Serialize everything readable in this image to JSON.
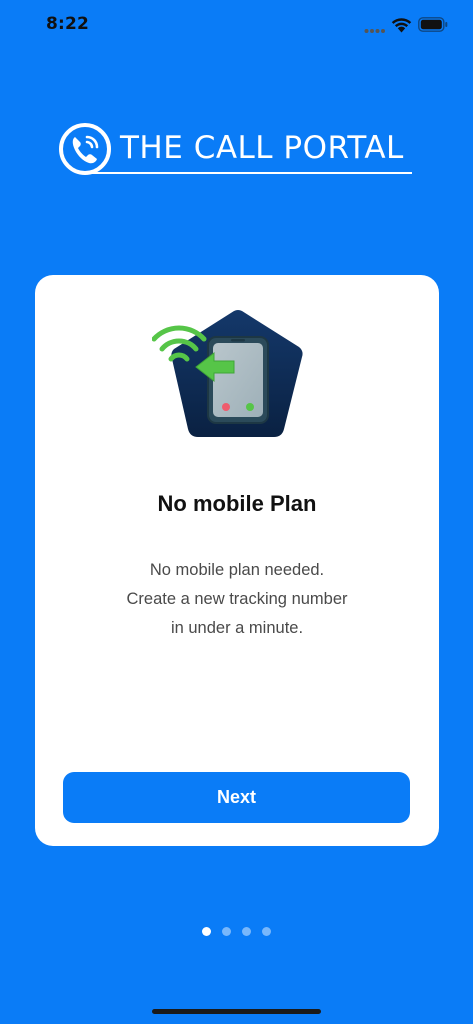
{
  "status_bar": {
    "time": "8:22"
  },
  "logo": {
    "text": "THE CALL PORTAL",
    "icon": "phone-call-icon"
  },
  "card": {
    "illustration": "phone-wifi-illustration",
    "title": "No mobile Plan",
    "description": [
      "No mobile plan needed.",
      "Create a new tracking number",
      "in under a minute."
    ],
    "button_label": "Next"
  },
  "pager": {
    "total": 4,
    "active": 0
  },
  "colors": {
    "background": "#0a7cf7",
    "card": "#ffffff",
    "button": "#0a7cf7",
    "illustration_navy": "#0d2c55",
    "wifi_green": "#56c548"
  }
}
